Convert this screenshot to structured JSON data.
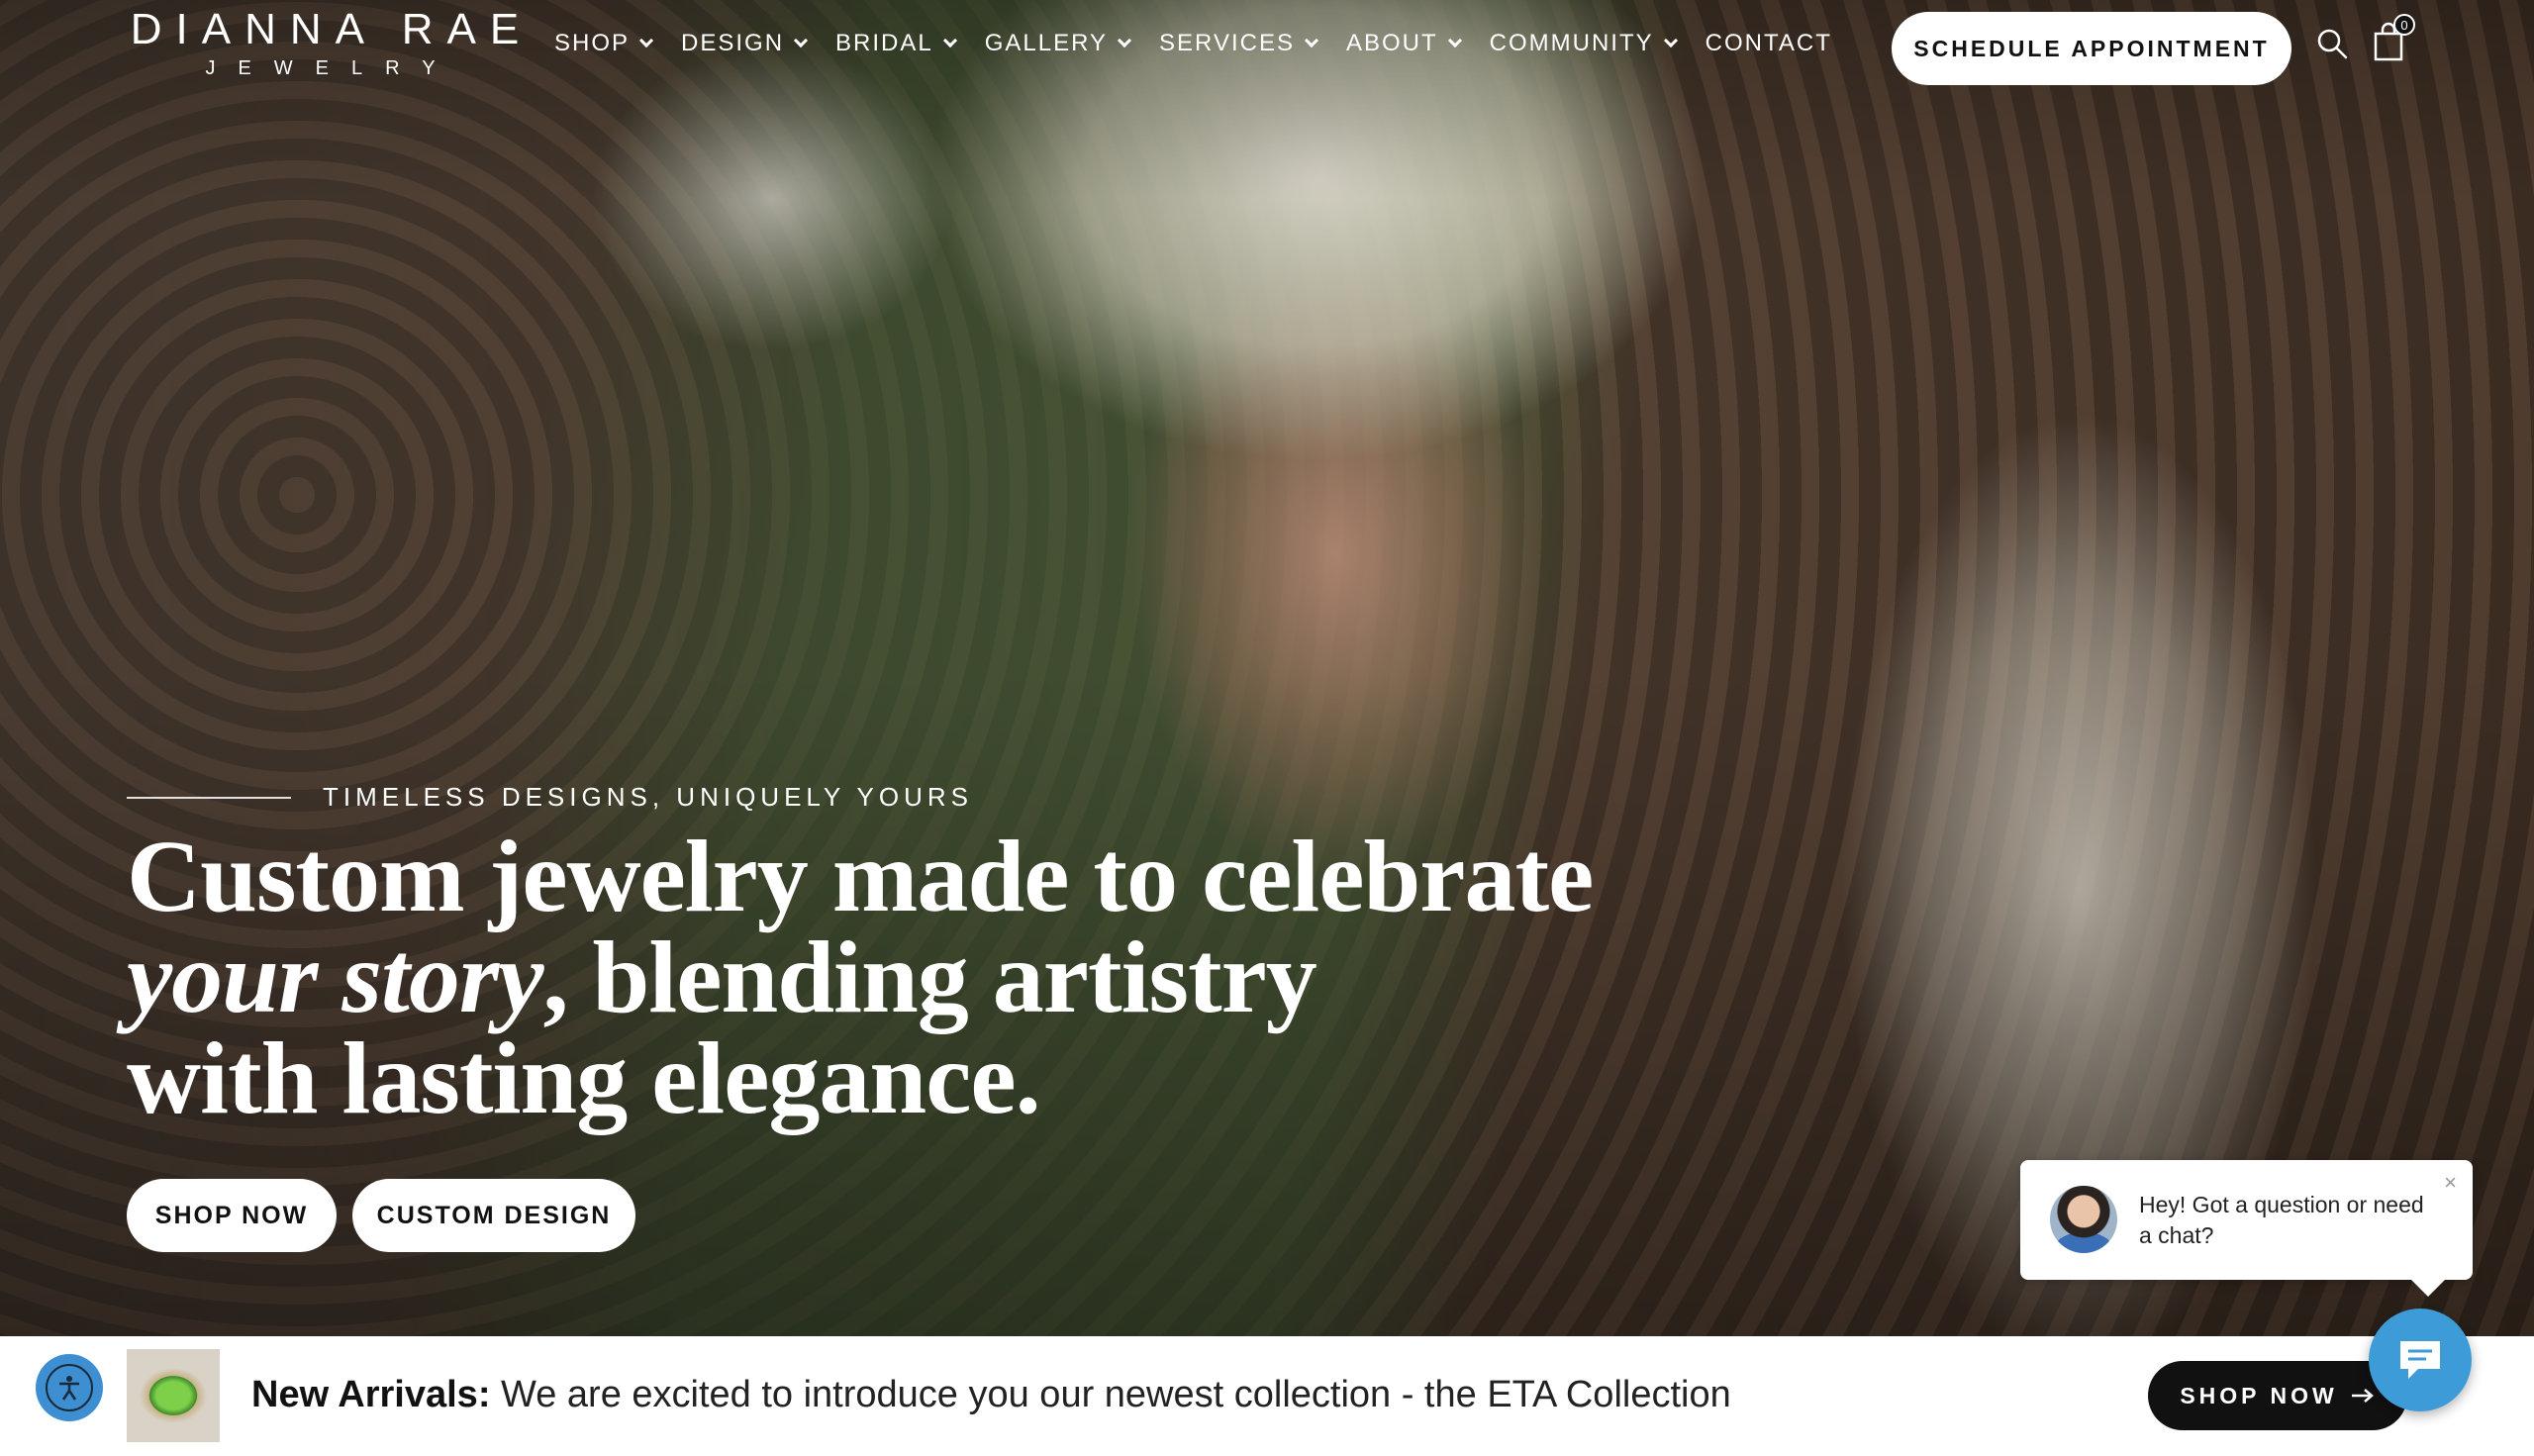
{
  "brand": {
    "name": "DIANNA RAE",
    "tagline": "JEWELRY"
  },
  "nav": {
    "items": [
      {
        "label": "SHOP",
        "dropdown": true
      },
      {
        "label": "DESIGN",
        "dropdown": true
      },
      {
        "label": "BRIDAL",
        "dropdown": true
      },
      {
        "label": "GALLERY",
        "dropdown": true
      },
      {
        "label": "SERVICES",
        "dropdown": true
      },
      {
        "label": "ABOUT",
        "dropdown": true
      },
      {
        "label": "COMMUNITY",
        "dropdown": true
      },
      {
        "label": "CONTACT",
        "dropdown": false
      }
    ],
    "schedule_label": "SCHEDULE APPOINTMENT",
    "cart_count": "0"
  },
  "hero": {
    "eyebrow": "TIMELESS DESIGNS, UNIQUELY YOURS",
    "headline_line1": "Custom jewelry made to celebrate",
    "headline_italic": "your story",
    "headline_line2_rest": ", blending artistry",
    "headline_line3": "with lasting elegance.",
    "shop_label": "SHOP NOW",
    "custom_label": "CUSTOM DESIGN"
  },
  "chat": {
    "message": "Hey! Got a question or need a chat?",
    "close_glyph": "×"
  },
  "announcement": {
    "bold": "New Arrivals:",
    "text": " We are excited to introduce you our newest collection - the ETA Collection",
    "button_label": "SHOP NOW"
  },
  "colors": {
    "accent_blue": "#3d9bd8",
    "dark": "#111111",
    "white": "#ffffff"
  }
}
